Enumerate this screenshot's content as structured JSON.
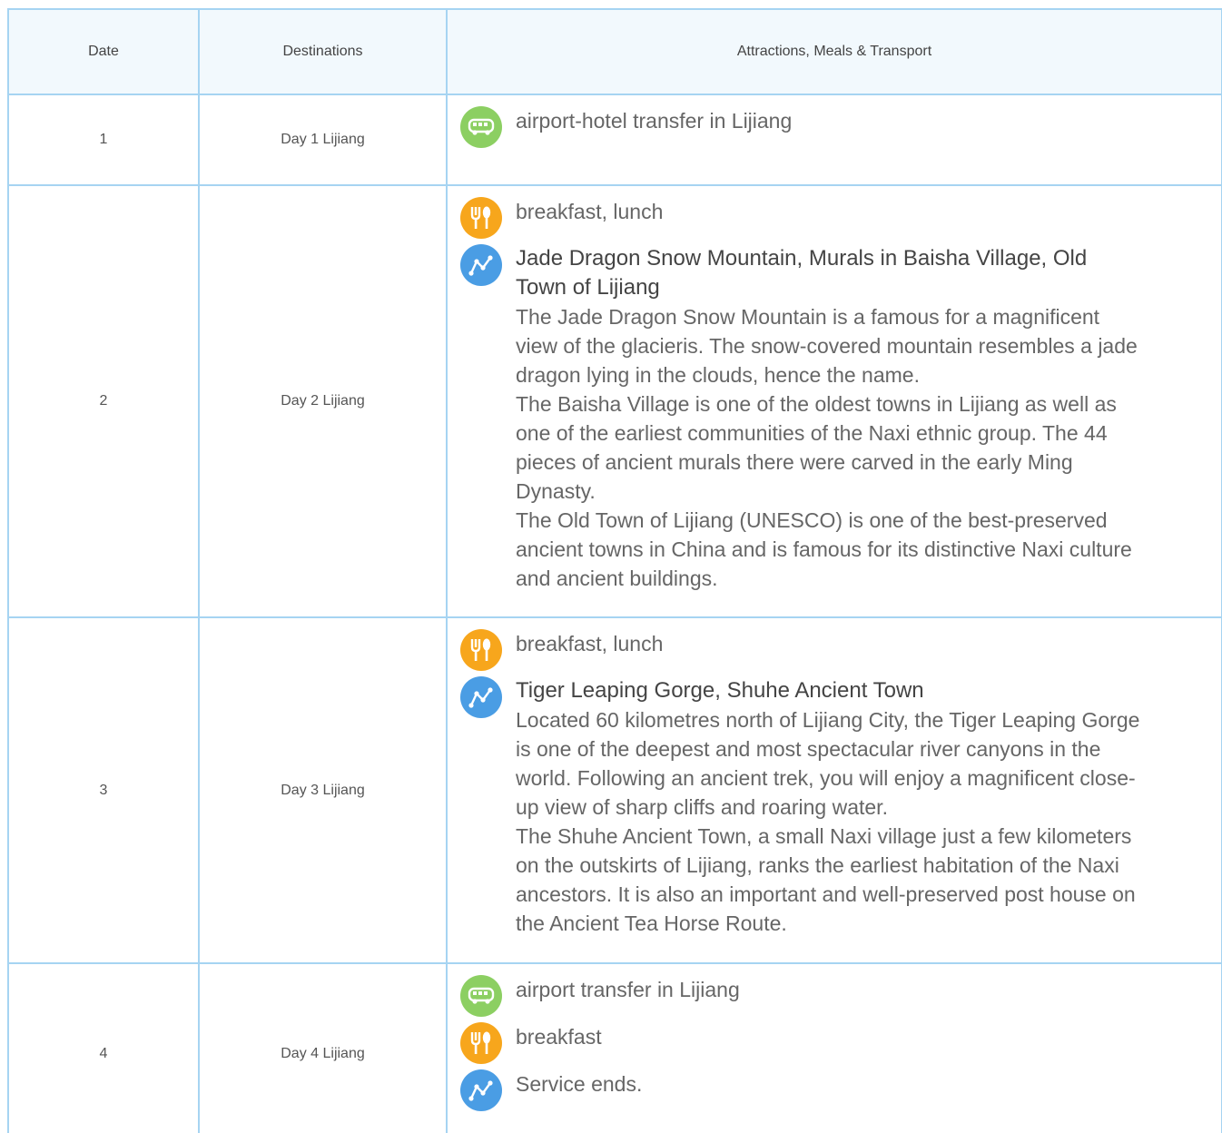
{
  "header": {
    "date": "Date",
    "destinations": "Destinations",
    "attractions": "Attractions, Meals & Transport"
  },
  "colors": {
    "border": "#a6d4f2",
    "bus_icon": "#8ccf62",
    "meal_icon": "#f7a61c",
    "route_icon": "#4a9de4"
  },
  "rows": [
    {
      "date": "1",
      "destination": "Day 1 Lijiang",
      "items": [
        {
          "icon": "bus-icon",
          "text": "airport-hotel transfer in Lijiang"
        }
      ]
    },
    {
      "date": "2",
      "destination": "Day 2 Lijiang",
      "items": [
        {
          "icon": "meal-icon",
          "text": "breakfast, lunch"
        },
        {
          "icon": "route-icon",
          "title": "Jade Dragon Snow Mountain, Murals in Baisha Village, Old Town of Lijiang",
          "desc": "The Jade Dragon Snow Mountain is a famous for a magnificent view of the glacieris. The snow-covered mountain resembles a jade dragon lying in the clouds, hence the name.\nThe Baisha Village is one of the oldest towns in Lijiang as well as one of the earliest communities of the Naxi ethnic group. The 44 pieces of ancient murals there were carved in the early Ming Dynasty.\nThe Old Town of Lijiang (UNESCO) is one of the best-preserved ancient towns in China and is famous for its distinctive Naxi culture and ancient buildings."
        }
      ]
    },
    {
      "date": "3",
      "destination": "Day 3 Lijiang",
      "items": [
        {
          "icon": "meal-icon",
          "text": "breakfast, lunch"
        },
        {
          "icon": "route-icon",
          "title": "Tiger Leaping Gorge, Shuhe Ancient Town",
          "desc": "Located 60 kilometres north of Lijiang City, the Tiger Leaping Gorge is one of the deepest and most spectacular river canyons in the world. Following an ancient trek, you will enjoy a magnificent close-up view of sharp cliffs and roaring water.\nThe Shuhe Ancient Town, a small Naxi village just a few kilometers on the outskirts of Lijiang, ranks the earliest habitation of the Naxi ancestors. It is also an important and well-preserved post house on the Ancient Tea Horse Route."
        }
      ]
    },
    {
      "date": "4",
      "destination": "Day 4 Lijiang",
      "items": [
        {
          "icon": "bus-icon",
          "text": "airport transfer in Lijiang"
        },
        {
          "icon": "meal-icon",
          "text": "breakfast"
        },
        {
          "icon": "route-icon",
          "text": "Service ends."
        }
      ]
    }
  ]
}
